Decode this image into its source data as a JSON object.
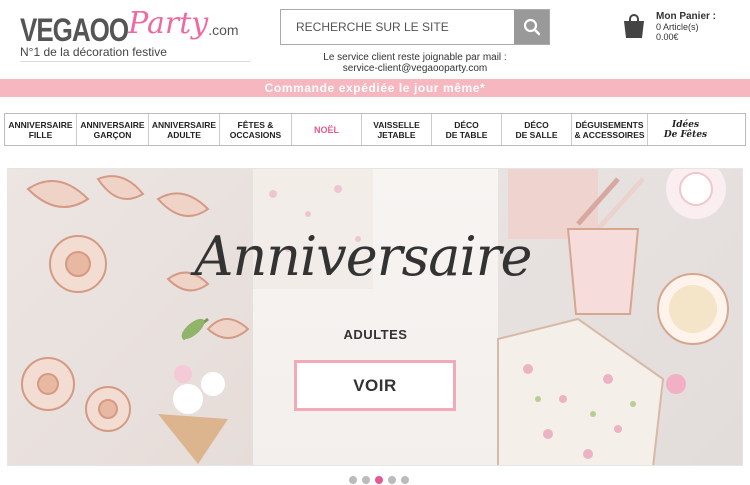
{
  "logo": {
    "brand_part1": "VEGAOO",
    "brand_part2": "Party",
    "brand_suffix": ".com",
    "tagline": "N°1 de la décoration festive",
    "accent_color": "#ee6aa0"
  },
  "search": {
    "placeholder": "RECHERCHE SUR LE SITE",
    "icon": "search-icon"
  },
  "service": {
    "line1": "Le service client reste joignable par mail :",
    "line2": "service-client@vegaooparty.com"
  },
  "cart": {
    "icon": "shopping-bag-icon",
    "title": "Mon Panier :",
    "count": "0 Article(s)",
    "total": "0.00€"
  },
  "shipping_banner": {
    "text": "Commande expédiée le jour même*",
    "color": "#f6b7c0"
  },
  "nav": {
    "items": [
      {
        "line1": "ANNIVERSAIRE",
        "line2": "FILLE"
      },
      {
        "line1": "ANNIVERSAIRE",
        "line2": "GARÇON"
      },
      {
        "line1": "ANNIVERSAIRE",
        "line2": "ADULTE"
      },
      {
        "line1": "FÊTES &",
        "line2": "OCCASIONS"
      },
      {
        "line1": "NOËL",
        "line2": ""
      },
      {
        "line1": "VAISSELLE",
        "line2": "JETABLE"
      },
      {
        "line1": "DÉCO",
        "line2": "DE TABLE"
      },
      {
        "line1": "DÉCO",
        "line2": "DE SALLE"
      },
      {
        "line1": "DÉGUISEMENTS",
        "line2": "& ACCESSOIRES"
      },
      {
        "line1": "Idées",
        "line2": "De Fêtes"
      }
    ],
    "highlight_color": "#e35a90"
  },
  "hero": {
    "title": "Anniversaire",
    "subtitle": "ADULTES",
    "cta_label": "VOIR",
    "cta_border_color": "#f2a9b8"
  },
  "carousel": {
    "slide_count": 5,
    "active_index": 2
  }
}
